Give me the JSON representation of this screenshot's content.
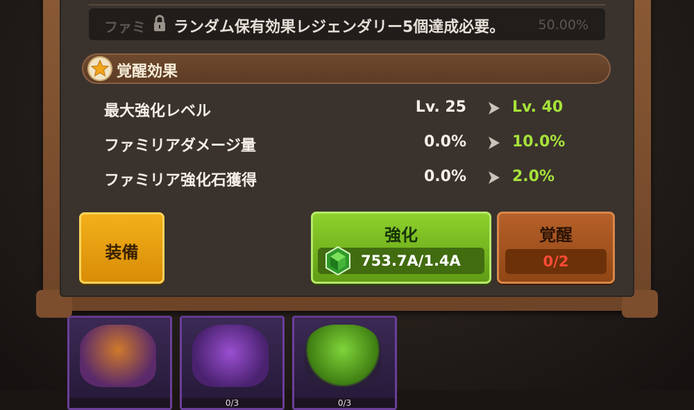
{
  "lock_bar": {
    "ghost_text": "ファミ",
    "ghost_percent": "50.00%",
    "message": "ランダム保有効果レジェンダリー5個達成必要。"
  },
  "awakening_section": {
    "title": "覚醒効果",
    "icon": "star-icon"
  },
  "stats": [
    {
      "label": "最大強化レベル",
      "current": "Lv. 25",
      "next": "Lv. 40"
    },
    {
      "label": "ファミリアダメージ量",
      "current": "0.0%",
      "next": "10.0%"
    },
    {
      "label": "ファミリア強化石獲得",
      "current": "0.0%",
      "next": "2.0%"
    }
  ],
  "buttons": {
    "equip": {
      "label": "装備"
    },
    "upgrade": {
      "label": "強化",
      "cost": "753.7A/1.4A",
      "cost_icon": "green-gem-icon"
    },
    "awaken": {
      "label": "覚醒",
      "count": "0/2"
    }
  },
  "background_cards": [
    {
      "count": ""
    },
    {
      "count": "0/3"
    },
    {
      "count": "0/3"
    }
  ],
  "colors": {
    "next_value": "#a6e23a",
    "awaken_count": "#ff4a36",
    "equip_button": "#f3b11b",
    "upgrade_button": "#8fd32d",
    "awaken_button": "#b8612a"
  }
}
